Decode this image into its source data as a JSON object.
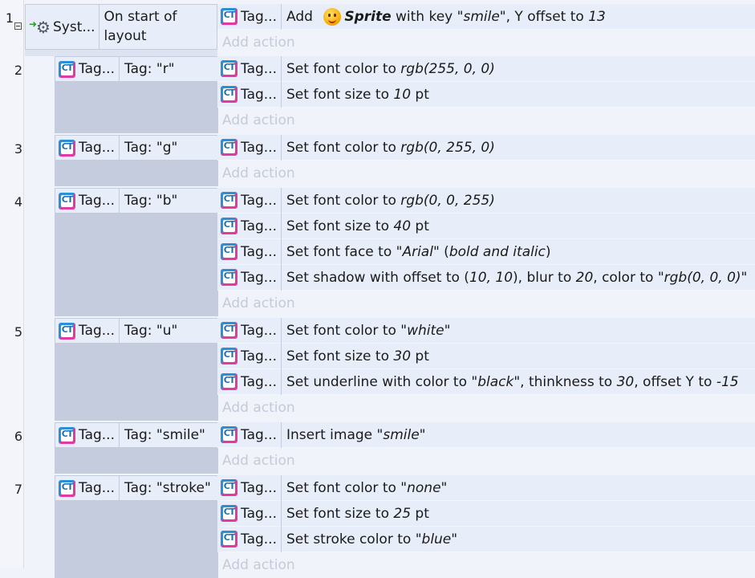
{
  "events": [
    {
      "number": "1",
      "condition": {
        "object": "Syst...",
        "text": "On start of layout"
      },
      "actions": [
        {
          "object": "Tag...",
          "parts": [
            "Add",
            " ",
            "@sprite",
            "Sprite",
            " with key ",
            "\"smile\"",
            ", Y offset to ",
            "13"
          ]
        }
      ],
      "add_action": "Add action"
    },
    {
      "number": "2",
      "condition": {
        "object": "Tag...",
        "text": "Tag: \"r\""
      },
      "actions": [
        {
          "object": "Tag...",
          "plain": "Set font color to ",
          "value": "rgb(255, 0, 0)"
        },
        {
          "object": "Tag...",
          "plain": "Set font size to ",
          "value": "10",
          "suffix": " pt"
        }
      ],
      "add_action": "Add action"
    },
    {
      "number": "3",
      "condition": {
        "object": "Tag...",
        "text": "Tag: \"g\""
      },
      "actions": [
        {
          "object": "Tag...",
          "plain": "Set font color to ",
          "value": "rgb(0, 255, 0)"
        }
      ],
      "add_action": "Add action"
    },
    {
      "number": "4",
      "condition": {
        "object": "Tag...",
        "text": "Tag: \"b\""
      },
      "actions": [
        {
          "object": "Tag...",
          "plain": "Set font color to ",
          "value": "rgb(0, 0, 255)"
        },
        {
          "object": "Tag...",
          "plain": "Set font size to ",
          "value": "40",
          "suffix": " pt"
        },
        {
          "object": "Tag...",
          "plain": "Set font face to ",
          "value": "\"Arial\"",
          "suffix": " (",
          "value2": "bold and italic",
          "suffix2": ")"
        },
        {
          "object": "Tag...",
          "plain": "Set shadow with offset to (",
          "value": "10, 10",
          "suffix": "), blur to ",
          "value2": "20",
          "suffix2": ", color to ",
          "value3": "\"rgb(0, 0, 0)\""
        }
      ],
      "add_action": "Add action"
    },
    {
      "number": "5",
      "condition": {
        "object": "Tag...",
        "text": "Tag: \"u\""
      },
      "actions": [
        {
          "object": "Tag...",
          "plain": "Set font color to ",
          "value": "\"white\""
        },
        {
          "object": "Tag...",
          "plain": "Set font size to ",
          "value": "30",
          "suffix": " pt"
        },
        {
          "object": "Tag...",
          "plain": "Set underline with color to ",
          "value": "\"black\"",
          "suffix": ", thinkness to ",
          "value2": "30",
          "suffix2": ", offset Y to ",
          "value3": "-15"
        }
      ],
      "add_action": "Add action"
    },
    {
      "number": "6",
      "condition": {
        "object": "Tag...",
        "text": "Tag: \"smile\""
      },
      "actions": [
        {
          "object": "Tag...",
          "plain": "Insert image ",
          "value": "\"smile\""
        }
      ],
      "add_action": "Add action"
    },
    {
      "number": "7",
      "condition": {
        "object": "Tag...",
        "text": "Tag: \"stroke\""
      },
      "actions": [
        {
          "object": "Tag...",
          "plain": "Set font color to ",
          "value": "\"none\""
        },
        {
          "object": "Tag...",
          "plain": "Set font size to ",
          "value": "25",
          "suffix": " pt"
        },
        {
          "object": "Tag...",
          "plain": "Set stroke color to ",
          "value": "\"blue\""
        }
      ],
      "add_action": "Add action"
    }
  ],
  "icons": {
    "system": "system-gear-icon",
    "tag": "tagtext-plugin-icon",
    "sprite": "sprite-smiley-icon"
  }
}
